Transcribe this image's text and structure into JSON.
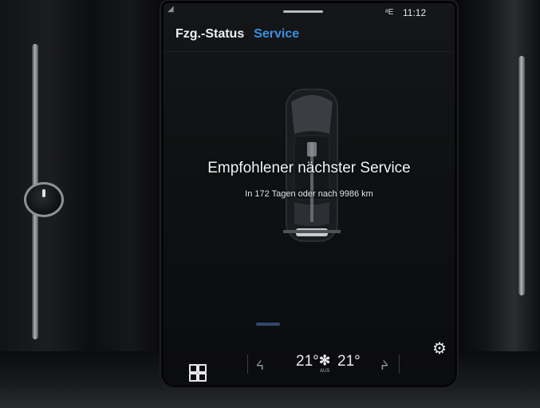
{
  "status_bar": {
    "time": "11:12",
    "signal_icon": "signal-icon",
    "network_indicator": "ᵃE"
  },
  "header": {
    "tab_vehicle_status": "Fzg.-Status",
    "tab_service": "Service"
  },
  "service": {
    "title": "Empfohlener nächster Service",
    "detail": "In 172 Tagen oder nach 9986 km"
  },
  "climate": {
    "temp_left": "21°",
    "temp_right": "21°",
    "fan_mode": "AUS"
  },
  "icons": {
    "home": "home-grid-icon",
    "settings": "gear-icon",
    "seat_left": "seat-heat-left-icon",
    "seat_right": "seat-heat-right-icon",
    "fan": "fan-icon"
  },
  "colors": {
    "accent": "#3b8fe0",
    "text": "#f2f3f5",
    "screen_bg": "#0f1112"
  }
}
